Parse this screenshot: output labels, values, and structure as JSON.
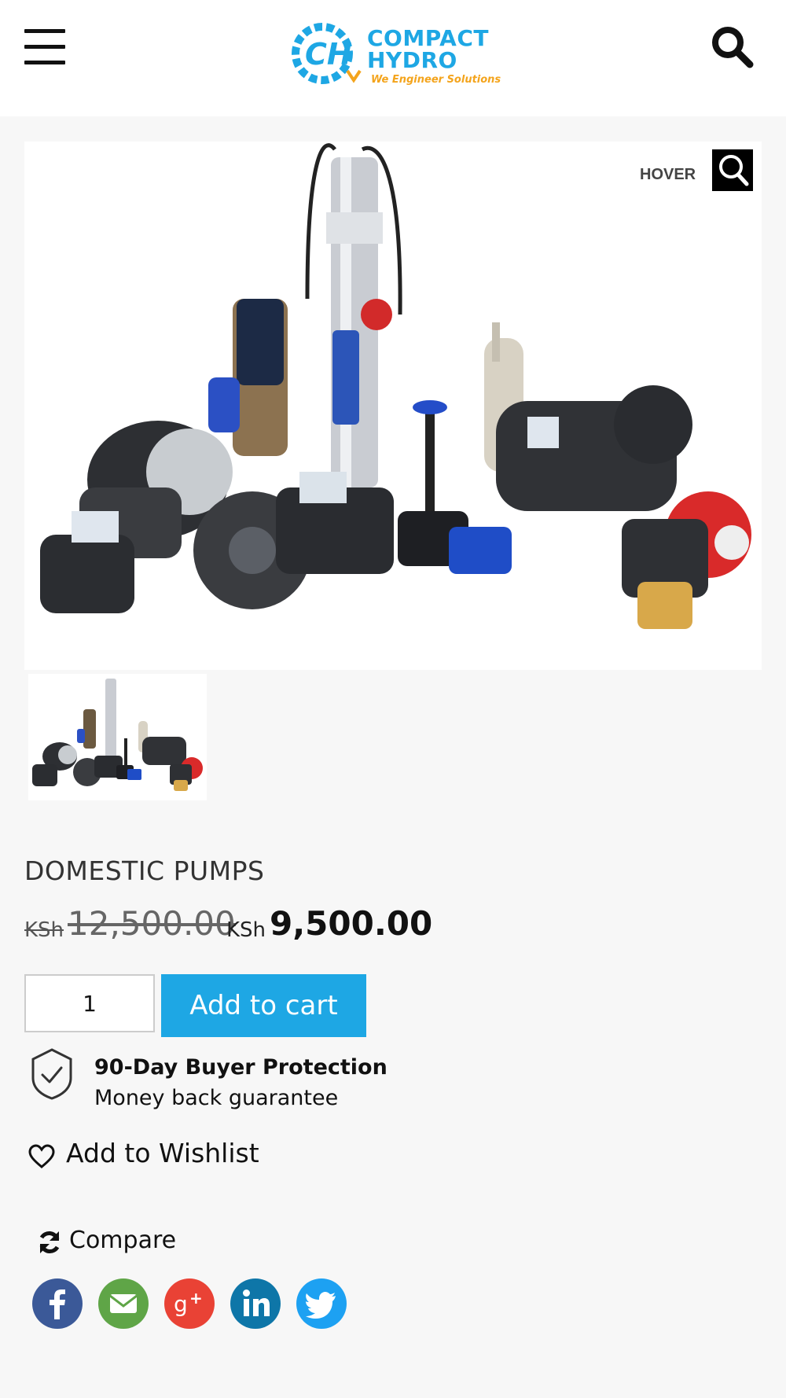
{
  "header": {
    "logo_line1": "COMPACT",
    "logo_line2": "HYDRO",
    "logo_tagline": "We Engineer Solutions"
  },
  "gallery": {
    "hover_label": "HOVER"
  },
  "product": {
    "title": "DOMESTIC PUMPS",
    "old_price_currency": "KSh",
    "old_price_value": "12,500.00",
    "new_price_currency": "KSh",
    "new_price_value": "9,500.00"
  },
  "cart": {
    "quantity": "1",
    "add_to_cart_label": "Add to cart"
  },
  "protection": {
    "title": "90-Day Buyer Protection",
    "subtitle": "Money back guarantee"
  },
  "wishlist": {
    "label": "Add to Wishlist"
  },
  "compare": {
    "label": "Compare"
  },
  "social": [
    {
      "name": "facebook-icon",
      "color": "#3b5998"
    },
    {
      "name": "email-icon",
      "color": "#5fa547"
    },
    {
      "name": "google-plus-icon",
      "color": "#e94235"
    },
    {
      "name": "linkedin-icon",
      "color": "#0e76a8"
    },
    {
      "name": "twitter-icon",
      "color": "#1da1f2"
    }
  ],
  "colors": {
    "accent": "#1ea7e4",
    "logo_orange": "#f4a41c"
  }
}
